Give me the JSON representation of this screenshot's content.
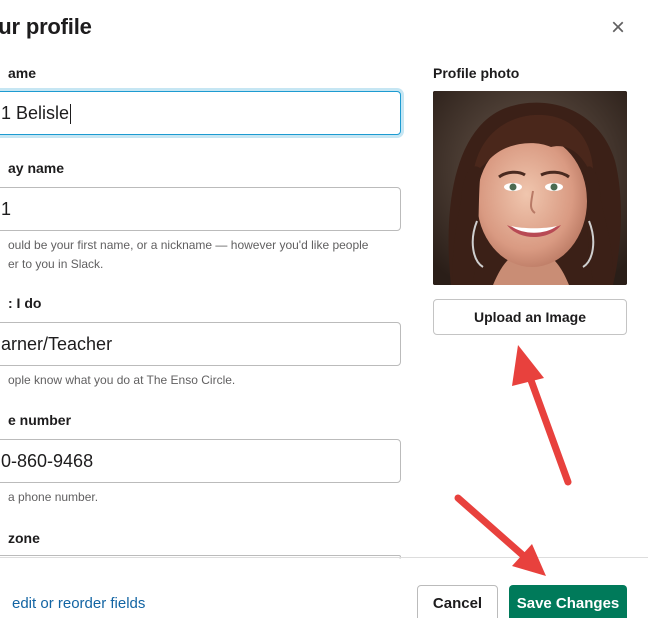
{
  "modal": {
    "title": "t your profile",
    "close_symbol": "×"
  },
  "fields": [
    {
      "label": "ame",
      "value": "1 Belisle",
      "hint": ""
    },
    {
      "label": "ay name",
      "value": "1",
      "hint_line1": "ould be your first name, or a nickname — however you'd like people",
      "hint_line2": "er to you in Slack."
    },
    {
      "label": ": I do",
      "value": "arner/Teacher",
      "hint": "ople know what you do at The Enso Circle."
    },
    {
      "label": "e number",
      "value": "0-860-9468",
      "hint": "a phone number."
    },
    {
      "label": "zone"
    }
  ],
  "photo": {
    "label": "Profile photo",
    "upload_label": "Upload an Image"
  },
  "footer": {
    "edit_link": "edit or reorder fields",
    "cancel_label": "Cancel",
    "save_label": "Save Changes"
  },
  "colors": {
    "save_green": "#007a5a",
    "link_blue": "#1264a3",
    "focus_blue": "#1d9bd1",
    "arrow_red": "#e8413d"
  }
}
